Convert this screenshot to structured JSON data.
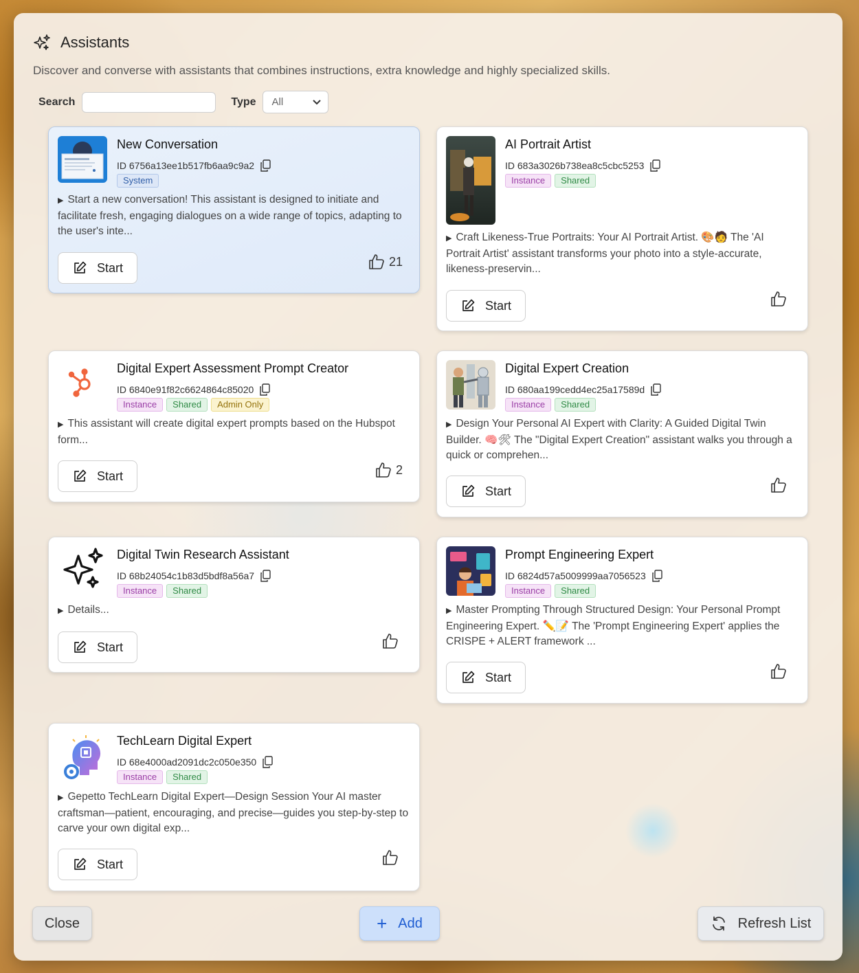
{
  "dialog": {
    "title": "Assistants",
    "subtitle": "Discover and converse with assistants that combines instructions, extra knowledge and highly specialized skills."
  },
  "filters": {
    "search_label": "Search",
    "search_value": "",
    "type_label": "Type",
    "type_value": "All"
  },
  "cards": [
    {
      "title": "New Conversation",
      "id": "ID 6756a13ee1b517fb6aa9c9a2",
      "badges": [
        "System"
      ],
      "description": "Start a new conversation! This assistant is designed to initiate and facilitate fresh, engaging dialogues on a wide range of topics, adapting to the user's inte...",
      "start_label": "Start",
      "likes": "21"
    },
    {
      "title": "AI Portrait Artist",
      "id": "ID 683a3026b738ea8c5cbc5253",
      "badges": [
        "Instance",
        "Shared"
      ],
      "description": "Craft Likeness-True Portraits: Your AI Portrait Artist. 🎨🧑 The 'AI Portrait Artist' assistant transforms your photo into a style-accurate, likeness-preservin...",
      "start_label": "Start",
      "likes": ""
    },
    {
      "title": "Digital Expert Assessment Prompt Creator",
      "id": "ID 6840e91f82c6624864c85020",
      "badges": [
        "Instance",
        "Shared",
        "Admin Only"
      ],
      "description": "This assistant will create digital expert prompts based on the Hubspot form...",
      "start_label": "Start",
      "likes": "2"
    },
    {
      "title": "Digital Expert Creation",
      "id": "ID 680aa199cedd4ec25a17589d",
      "badges": [
        "Instance",
        "Shared"
      ],
      "description": "Design Your Personal AI Expert with Clarity: A Guided Digital Twin Builder. 🧠🛠 The \"Digital Expert Creation\" assistant walks you through a quick or comprehen...",
      "start_label": "Start",
      "likes": ""
    },
    {
      "title": "Digital Twin Research Assistant",
      "id": "ID 68b24054c1b83d5bdf8a56a7",
      "badges": [
        "Instance",
        "Shared"
      ],
      "description": "Details...",
      "start_label": "Start",
      "likes": ""
    },
    {
      "title": "Prompt Engineering Expert",
      "id": "ID 6824d57a5009999aa7056523",
      "badges": [
        "Instance",
        "Shared"
      ],
      "description": "Master Prompting Through Structured Design: Your Personal Prompt Engineering Expert. ✏️📝 The 'Prompt Engineering Expert' applies the CRISPE + ALERT framework ...",
      "start_label": "Start",
      "likes": ""
    },
    {
      "title": "TechLearn Digital Expert",
      "id": "ID 68e4000ad2091dc2c050e350",
      "badges": [
        "Instance",
        "Shared"
      ],
      "description": "Gepetto TechLearn Digital Expert—Design Session Your AI master craftsman—patient, encouraging, and precise—guides you step-by-step to carve your own digital exp...",
      "start_label": "Start",
      "likes": ""
    }
  ],
  "footer": {
    "close_label": "Close",
    "add_label": "Add",
    "refresh_label": "Refresh List"
  },
  "icons": {
    "header": "sparkles-icon",
    "copy": "copy-icon",
    "start": "edit-icon",
    "like": "thumbs-up-icon",
    "refresh": "refresh-icon"
  },
  "colors": {
    "accent": "#1e5dd2",
    "system_badge": "#2f5ea8",
    "instance_badge": "#9a3ea6",
    "shared_badge": "#2f8a45",
    "admin_badge": "#94720c"
  }
}
